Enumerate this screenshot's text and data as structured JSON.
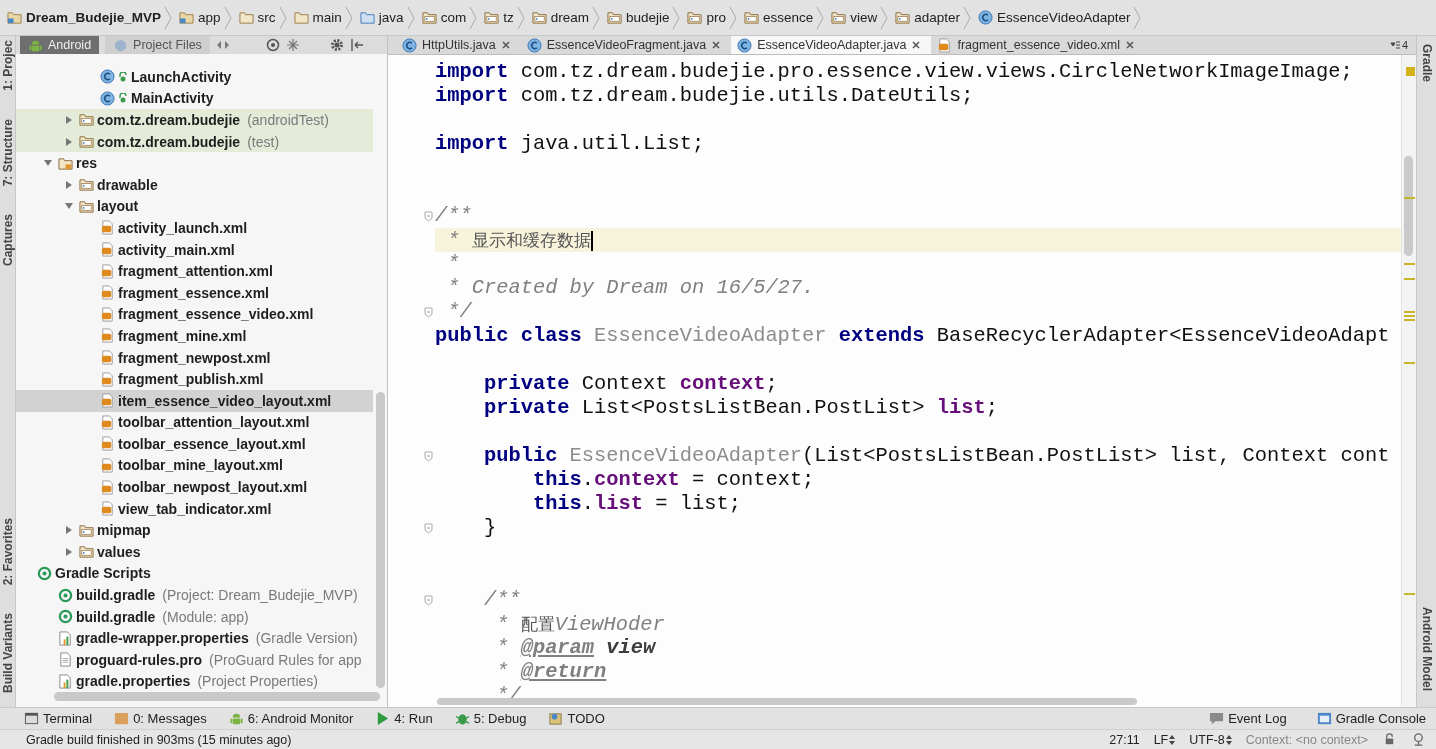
{
  "breadcrumb": [
    {
      "label": "Dream_Budejie_MVP",
      "kind": "module"
    },
    {
      "label": "app",
      "kind": "module"
    },
    {
      "label": "src",
      "kind": "folder"
    },
    {
      "label": "main",
      "kind": "folder"
    },
    {
      "label": "java",
      "kind": "source"
    },
    {
      "label": "com",
      "kind": "package"
    },
    {
      "label": "tz",
      "kind": "package"
    },
    {
      "label": "dream",
      "kind": "package"
    },
    {
      "label": "budejie",
      "kind": "package"
    },
    {
      "label": "pro",
      "kind": "package"
    },
    {
      "label": "essence",
      "kind": "package"
    },
    {
      "label": "view",
      "kind": "package"
    },
    {
      "label": "adapter",
      "kind": "package"
    },
    {
      "label": "EssenceVideoAdapter",
      "kind": "class"
    }
  ],
  "left_strip": {
    "top": [
      {
        "label": "1: Projec"
      },
      {
        "label": "7: Structure"
      },
      {
        "label": "Captures"
      }
    ],
    "bottom": [
      {
        "label": "2: Favorites"
      },
      {
        "label": "Build Variants"
      }
    ]
  },
  "right_strip": {
    "top": [
      {
        "label": "Gradle"
      }
    ],
    "bottom": [
      {
        "label": "Android Model"
      }
    ]
  },
  "project_panel": {
    "tabs": [
      {
        "label": "Android",
        "selected": true
      },
      {
        "label": "Project Files",
        "selected": false
      }
    ],
    "items": [
      {
        "children": [
          {
            "children": [
              {
                "children": [
                  {
                    "label": "LaunchActivity",
                    "kind": "class",
                    "selected": false,
                    "tinted": false
                  },
                  {
                    "label": "MainActivity",
                    "kind": "class",
                    "selected": false,
                    "tinted": false
                  }
                ]
              },
              {
                "label": "com.tz.dream.budejie",
                "note": "(androidTest)",
                "kind": "package",
                "expanded": false,
                "selected": false,
                "tinted": true
              },
              {
                "label": "com.tz.dream.budejie",
                "note": "(test)",
                "kind": "package",
                "expanded": false,
                "selected": false,
                "tinted": true
              }
            ]
          },
          {
            "label": "res",
            "kind": "res-folder",
            "expanded": true,
            "selected": false,
            "tinted": false,
            "children": [
              {
                "label": "drawable",
                "kind": "package",
                "expanded": false,
                "selected": false,
                "tinted": false
              },
              {
                "label": "layout",
                "kind": "package",
                "expanded": true,
                "selected": false,
                "tinted": false,
                "children": [
                  {
                    "label": "activity_launch.xml",
                    "kind": "xml",
                    "selected": false,
                    "tinted": false
                  },
                  {
                    "label": "activity_main.xml",
                    "kind": "xml",
                    "selected": false,
                    "tinted": false
                  },
                  {
                    "label": "fragment_attention.xml",
                    "kind": "xml",
                    "selected": false,
                    "tinted": false
                  },
                  {
                    "label": "fragment_essence.xml",
                    "kind": "xml",
                    "selected": false,
                    "tinted": false
                  },
                  {
                    "label": "fragment_essence_video.xml",
                    "kind": "xml",
                    "selected": false,
                    "tinted": false
                  },
                  {
                    "label": "fragment_mine.xml",
                    "kind": "xml",
                    "selected": false,
                    "tinted": false
                  },
                  {
                    "label": "fragment_newpost.xml",
                    "kind": "xml",
                    "selected": false,
                    "tinted": false
                  },
                  {
                    "label": "fragment_publish.xml",
                    "kind": "xml",
                    "selected": false,
                    "tinted": false
                  },
                  {
                    "label": "item_essence_video_layout.xml",
                    "kind": "xml",
                    "selected": true,
                    "tinted": false
                  },
                  {
                    "label": "toolbar_attention_layout.xml",
                    "kind": "xml",
                    "selected": false,
                    "tinted": false
                  },
                  {
                    "label": "toolbar_essence_layout.xml",
                    "kind": "xml",
                    "selected": false,
                    "tinted": false
                  },
                  {
                    "label": "toolbar_mine_layout.xml",
                    "kind": "xml",
                    "selected": false,
                    "tinted": false
                  },
                  {
                    "label": "toolbar_newpost_layout.xml",
                    "kind": "xml",
                    "selected": false,
                    "tinted": false
                  },
                  {
                    "label": "view_tab_indicator.xml",
                    "kind": "xml",
                    "selected": false,
                    "tinted": false
                  }
                ]
              },
              {
                "label": "mipmap",
                "kind": "package",
                "expanded": false,
                "selected": false,
                "tinted": false
              },
              {
                "label": "values",
                "kind": "package",
                "expanded": false,
                "selected": false,
                "tinted": false
              }
            ]
          }
        ]
      },
      {
        "label": "Gradle Scripts",
        "kind": "gradle",
        "selected": false,
        "tinted": false,
        "children": [
          {
            "label": "build.gradle",
            "note": "(Project: Dream_Budejie_MVP)",
            "kind": "gradle",
            "selected": false,
            "tinted": false
          },
          {
            "label": "build.gradle",
            "note": "(Module: app)",
            "kind": "gradle",
            "selected": false,
            "tinted": false
          },
          {
            "label": "gradle-wrapper.properties",
            "note": "(Gradle Version)",
            "kind": "properties",
            "selected": false,
            "tinted": false
          },
          {
            "label": "proguard-rules.pro",
            "note": "(ProGuard Rules for app",
            "kind": "text",
            "selected": false,
            "tinted": false
          },
          {
            "label": "gradle.properties",
            "note": "(Project Properties)",
            "kind": "properties",
            "selected": false,
            "tinted": false
          }
        ]
      }
    ]
  },
  "editor_tabs": [
    {
      "label": "HttpUtils.java",
      "kind": "java",
      "selected": false
    },
    {
      "label": "EssenceVideoFragment.java",
      "kind": "java",
      "selected": false
    },
    {
      "label": "EssenceVideoAdapter.java",
      "kind": "java",
      "selected": true
    },
    {
      "label": "fragment_essence_video.xml",
      "kind": "xml",
      "selected": false
    }
  ],
  "tab_count": "4",
  "code_lines": [
    {
      "kind": "code",
      "highlighted": false,
      "fold": false,
      "segments": [
        {
          "kind": "keyword",
          "text": "import"
        },
        {
          "kind": "plain",
          "text": " com.tz.dream.budejie.pro.essence.view.views.CircleNetworkImageImage;"
        }
      ]
    },
    {
      "kind": "code",
      "highlighted": false,
      "fold": false,
      "segments": [
        {
          "kind": "keyword",
          "text": "import"
        },
        {
          "kind": "plain",
          "text": " com.tz.dream.budejie.utils.DateUtils;"
        }
      ]
    },
    {
      "kind": "blank"
    },
    {
      "kind": "code",
      "highlighted": false,
      "fold": false,
      "segments": [
        {
          "kind": "keyword",
          "text": "import"
        },
        {
          "kind": "plain",
          "text": " java.util.List;"
        }
      ]
    },
    {
      "kind": "blank"
    },
    {
      "kind": "blank"
    },
    {
      "kind": "code",
      "highlighted": false,
      "fold": true,
      "segments": [
        {
          "kind": "comment",
          "text": "/**"
        }
      ]
    },
    {
      "kind": "code",
      "highlighted": true,
      "fold": false,
      "segments": [
        {
          "kind": "comment",
          "text": " * "
        },
        {
          "kind": "comment-text",
          "text": "显示和缓存数据"
        }
      ]
    },
    {
      "kind": "code",
      "highlighted": false,
      "fold": false,
      "segments": [
        {
          "kind": "comment",
          "text": " *"
        }
      ]
    },
    {
      "kind": "code",
      "highlighted": false,
      "fold": false,
      "segments": [
        {
          "kind": "comment",
          "text": " * Created by Dream on 16/5/27."
        }
      ]
    },
    {
      "kind": "code",
      "highlighted": false,
      "fold": true,
      "segments": [
        {
          "kind": "comment",
          "text": " */"
        }
      ]
    },
    {
      "kind": "code",
      "highlighted": false,
      "fold": false,
      "segments": [
        {
          "kind": "keyword",
          "text": "public class "
        },
        {
          "kind": "unused",
          "text": "EssenceVideoAdapter"
        },
        {
          "kind": "keyword",
          "text": " extends "
        },
        {
          "kind": "plain",
          "text": "BaseRecyclerAdapter<EssenceVideoAdapt"
        }
      ]
    },
    {
      "kind": "blank"
    },
    {
      "kind": "code",
      "highlighted": false,
      "fold": false,
      "segments": [
        {
          "kind": "keyword",
          "text": "    private "
        },
        {
          "kind": "plain",
          "text": "Context "
        },
        {
          "kind": "field",
          "text": "context"
        },
        {
          "kind": "plain",
          "text": ";"
        }
      ]
    },
    {
      "kind": "code",
      "highlighted": false,
      "fold": false,
      "segments": [
        {
          "kind": "keyword",
          "text": "    private "
        },
        {
          "kind": "plain",
          "text": "List<PostsListBean.PostList> "
        },
        {
          "kind": "field",
          "text": "list"
        },
        {
          "kind": "plain",
          "text": ";"
        }
      ]
    },
    {
      "kind": "blank"
    },
    {
      "kind": "code",
      "highlighted": false,
      "fold": true,
      "segments": [
        {
          "kind": "keyword",
          "text": "    public "
        },
        {
          "kind": "unused",
          "text": "EssenceVideoAdapter"
        },
        {
          "kind": "plain",
          "text": "(List<PostsListBean.PostList> list, Context cont"
        }
      ]
    },
    {
      "kind": "code",
      "highlighted": false,
      "fold": false,
      "segments": [
        {
          "kind": "keyword",
          "text": "        this"
        },
        {
          "kind": "plain",
          "text": "."
        },
        {
          "kind": "field",
          "text": "context"
        },
        {
          "kind": "plain",
          "text": " = context;"
        }
      ]
    },
    {
      "kind": "code",
      "highlighted": false,
      "fold": false,
      "segments": [
        {
          "kind": "keyword",
          "text": "        this"
        },
        {
          "kind": "plain",
          "text": "."
        },
        {
          "kind": "field",
          "text": "list"
        },
        {
          "kind": "plain",
          "text": " = list;"
        }
      ]
    },
    {
      "kind": "code",
      "highlighted": false,
      "fold": true,
      "segments": [
        {
          "kind": "plain",
          "text": "    }"
        }
      ]
    },
    {
      "kind": "blank"
    },
    {
      "kind": "blank"
    },
    {
      "kind": "code",
      "highlighted": false,
      "fold": true,
      "segments": [
        {
          "kind": "comment",
          "text": "    /**"
        }
      ]
    },
    {
      "kind": "code",
      "highlighted": false,
      "fold": false,
      "segments": [
        {
          "kind": "comment",
          "text": "     * "
        },
        {
          "kind": "comment-text",
          "text": "配置"
        },
        {
          "kind": "comment",
          "text": "ViewHoder"
        }
      ]
    },
    {
      "kind": "code",
      "highlighted": false,
      "fold": false,
      "segments": [
        {
          "kind": "comment",
          "text": "     * "
        },
        {
          "kind": "doc-tag",
          "text": "@param"
        },
        {
          "kind": "doc-param",
          "text": " view"
        }
      ]
    },
    {
      "kind": "code",
      "highlighted": false,
      "fold": false,
      "segments": [
        {
          "kind": "comment",
          "text": "     * "
        },
        {
          "kind": "doc-tag",
          "text": "@return"
        }
      ]
    },
    {
      "kind": "code",
      "highlighted": false,
      "fold": false,
      "segments": [
        {
          "kind": "comment",
          "text": "     */"
        }
      ]
    }
  ],
  "tool_buttons": {
    "left": [
      {
        "label": "Terminal",
        "kind": "terminal"
      },
      {
        "label": "0: Messages",
        "kind": "messages"
      },
      {
        "label": "6: Android Monitor",
        "kind": "android"
      },
      {
        "label": "4: Run",
        "kind": "run"
      },
      {
        "label": "5: Debug",
        "kind": "debug"
      },
      {
        "label": "TODO",
        "kind": "todo"
      }
    ],
    "right": [
      {
        "label": "Event Log",
        "kind": "log"
      },
      {
        "label": "Gradle Console",
        "kind": "console"
      }
    ]
  },
  "status_bar": {
    "message": "Gradle build finished in 903ms (15 minutes ago)",
    "position": "27:11",
    "line_separator": "LF",
    "encoding": "UTF-8",
    "context": "Context: <no context>"
  }
}
